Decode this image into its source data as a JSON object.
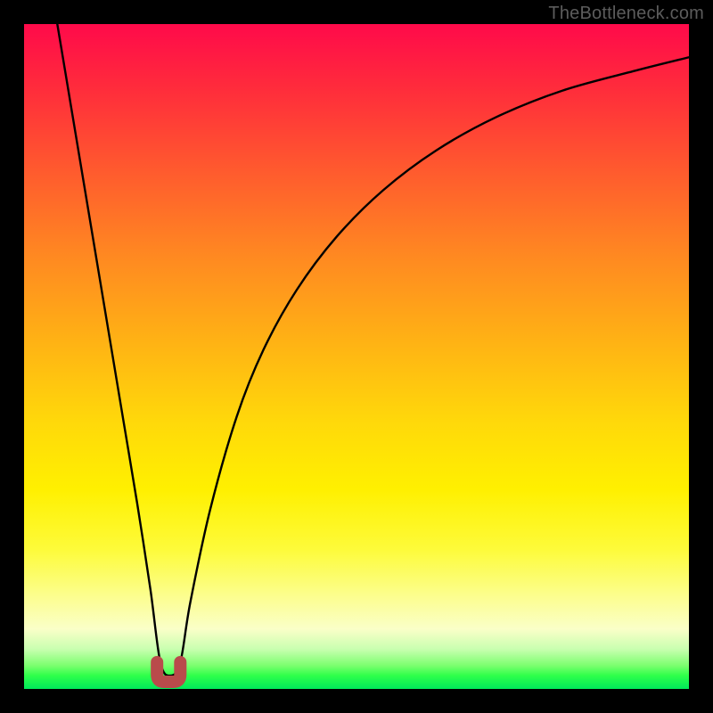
{
  "watermark": "TheBottleneck.com",
  "chart_data": {
    "type": "line",
    "title": "",
    "xlabel": "",
    "ylabel": "",
    "xlim": [
      0,
      100
    ],
    "ylim": [
      0,
      100
    ],
    "series": [
      {
        "name": "bottleneck-curve",
        "x": [
          5,
          7,
          9,
          11,
          13,
          15,
          17,
          19,
          20.5,
          22,
          23.5,
          25,
          28,
          32,
          36,
          41,
          47,
          54,
          62,
          71,
          81,
          92,
          100
        ],
        "y": [
          100,
          88,
          76,
          64,
          52,
          40,
          28,
          15,
          4,
          2,
          4,
          13,
          27,
          41,
          51,
          60,
          68,
          75,
          81,
          86,
          90,
          93,
          95
        ]
      }
    ],
    "marker": {
      "name": "optimum-u-marker",
      "x_range": [
        20,
        23.5
      ],
      "depth_pct": 2,
      "color": "#b94b4b"
    },
    "gradient_stops_pct_to_color": [
      [
        0,
        "#ff0a4a"
      ],
      [
        10,
        "#ff2d3b"
      ],
      [
        22,
        "#ff5a2e"
      ],
      [
        35,
        "#ff8921"
      ],
      [
        48,
        "#ffb314"
      ],
      [
        60,
        "#ffd90a"
      ],
      [
        70,
        "#fff000"
      ],
      [
        79,
        "#fdfb3a"
      ],
      [
        86,
        "#fcfe8e"
      ],
      [
        91,
        "#faffc8"
      ],
      [
        94,
        "#c9ffb0"
      ],
      [
        96.5,
        "#7bff6e"
      ],
      [
        98,
        "#2eff4a"
      ],
      [
        100,
        "#00e85a"
      ]
    ]
  }
}
